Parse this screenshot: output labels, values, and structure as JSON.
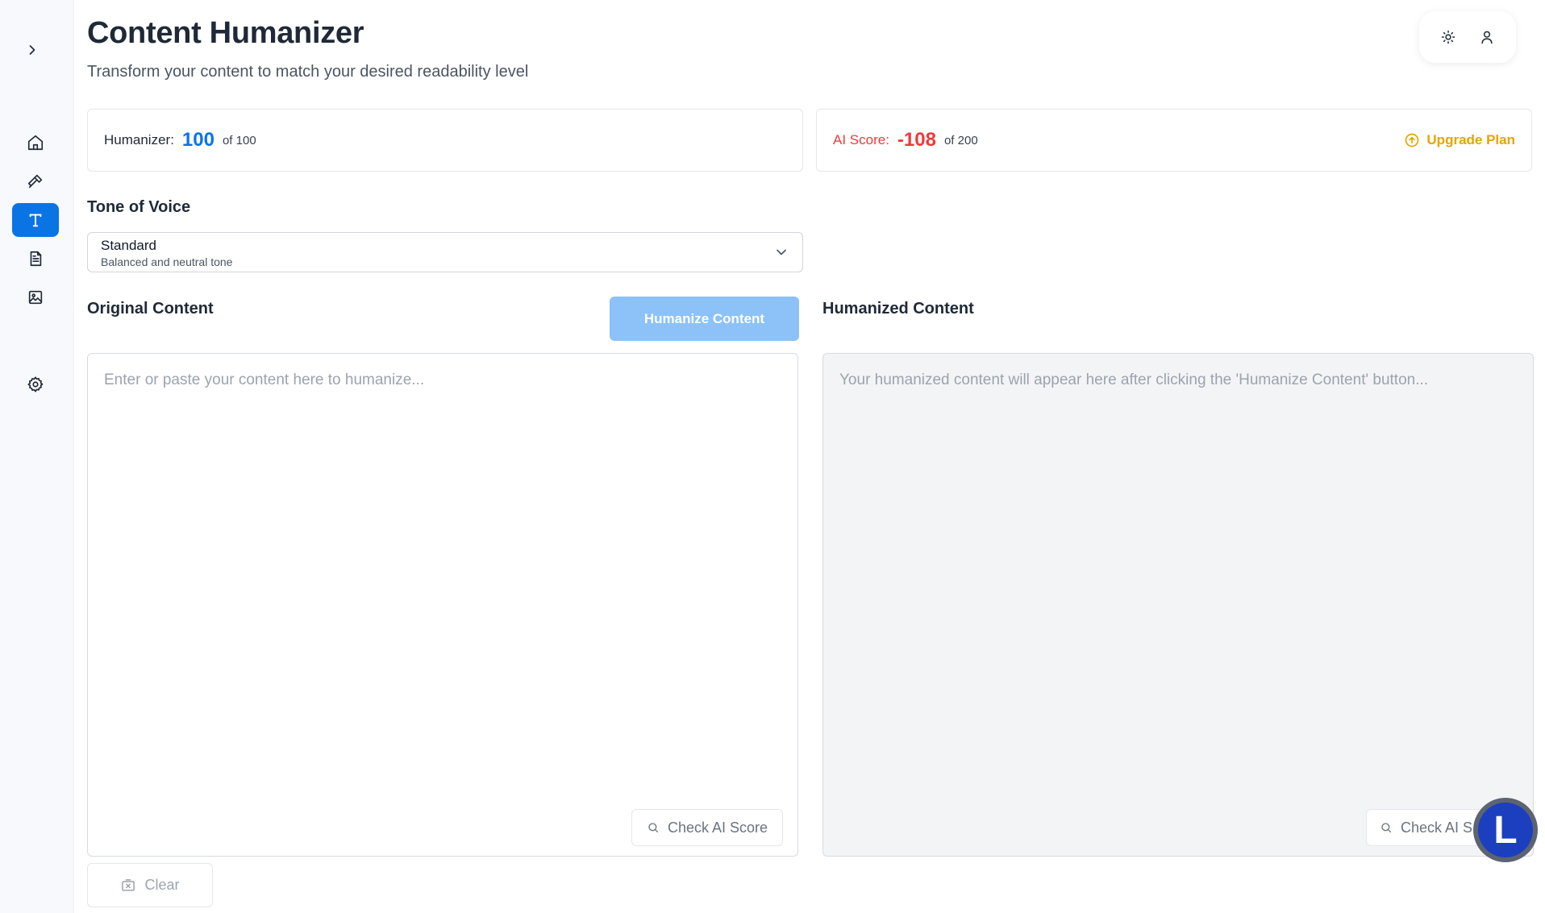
{
  "header": {
    "title": "Content Humanizer",
    "subtitle": "Transform your content to match your desired readability level"
  },
  "sidebar": {
    "toggle_icon": "chevron-right-icon",
    "items": [
      {
        "name": "home",
        "icon": "home-icon",
        "active": false
      },
      {
        "name": "tools",
        "icon": "hammer-icon",
        "active": false
      },
      {
        "name": "humanizer",
        "icon": "text-icon",
        "active": true
      },
      {
        "name": "documents",
        "icon": "document-icon",
        "active": false
      },
      {
        "name": "images",
        "icon": "image-icon",
        "active": false
      },
      {
        "name": "settings",
        "icon": "gear-icon",
        "active": false
      }
    ]
  },
  "top_actions": {
    "theme_icon": "sun-icon",
    "user_icon": "user-icon"
  },
  "humanizer_card": {
    "label": "Humanizer:",
    "value": "100",
    "of_text": "of 100"
  },
  "ai_score_card": {
    "label": "AI Score:",
    "value": "-108",
    "of_text": "of 200",
    "upgrade_label": "Upgrade Plan"
  },
  "tone": {
    "label": "Tone of Voice",
    "selected": "Standard",
    "selected_description": "Balanced and neutral tone"
  },
  "original": {
    "label": "Original Content",
    "placeholder": "Enter or paste your content here to humanize...",
    "check_label": "Check AI Score"
  },
  "humanize_button": "Humanize Content",
  "humanized": {
    "label": "Humanized Content",
    "placeholder": "Your humanized content will appear here after clicking the 'Humanize Content' button...",
    "check_label": "Check AI S"
  },
  "clear_label": "Clear",
  "floating_badge": "L",
  "colors": {
    "primary": "#0b74e5",
    "danger": "#ef3b3b",
    "warning": "#e6a400",
    "button_disabled": "#8cc2f7"
  }
}
